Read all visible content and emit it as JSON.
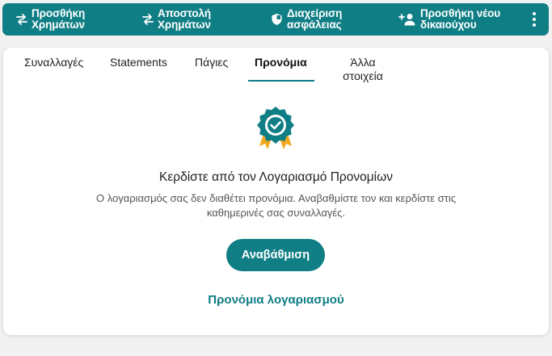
{
  "colors": {
    "brand": "#0f7e85",
    "badge_ribbon": "#f1a81e",
    "background": "#f1f1f1"
  },
  "top_actions": [
    {
      "label": "Προσθήκη\nΧρημάτων",
      "icon": "transfer-arrows-icon"
    },
    {
      "label": "Αποστολή\nΧρημάτων",
      "icon": "transfer-arrows-icon"
    },
    {
      "label": "Διαχείριση\nασφάλειας",
      "icon": "shield-icon"
    },
    {
      "label": "Προσθήκη νέου\nδικαιούχου",
      "icon": "add-person-icon"
    }
  ],
  "tabs": [
    {
      "label": "Συναλλαγές",
      "active": false
    },
    {
      "label": "Statements",
      "active": false
    },
    {
      "label": "Πάγιες",
      "active": false
    },
    {
      "label": "Προνόμια",
      "active": true
    },
    {
      "label": "Άλλα\nστοιχεία",
      "active": false
    }
  ],
  "promo": {
    "badge_icon": "award-badge-icon",
    "heading": "Κερδίστε από τον Λογαριασμό Προνομίων",
    "description": "Ο λογαριασμός σας δεν διαθέτει προνόμια. Αναβαθμίστε τον και κερδίστε στις καθημερινές σας συναλλαγές.",
    "button_label": "Αναβάθμιση",
    "link_label": "Προνόμια λογαριασμού"
  }
}
